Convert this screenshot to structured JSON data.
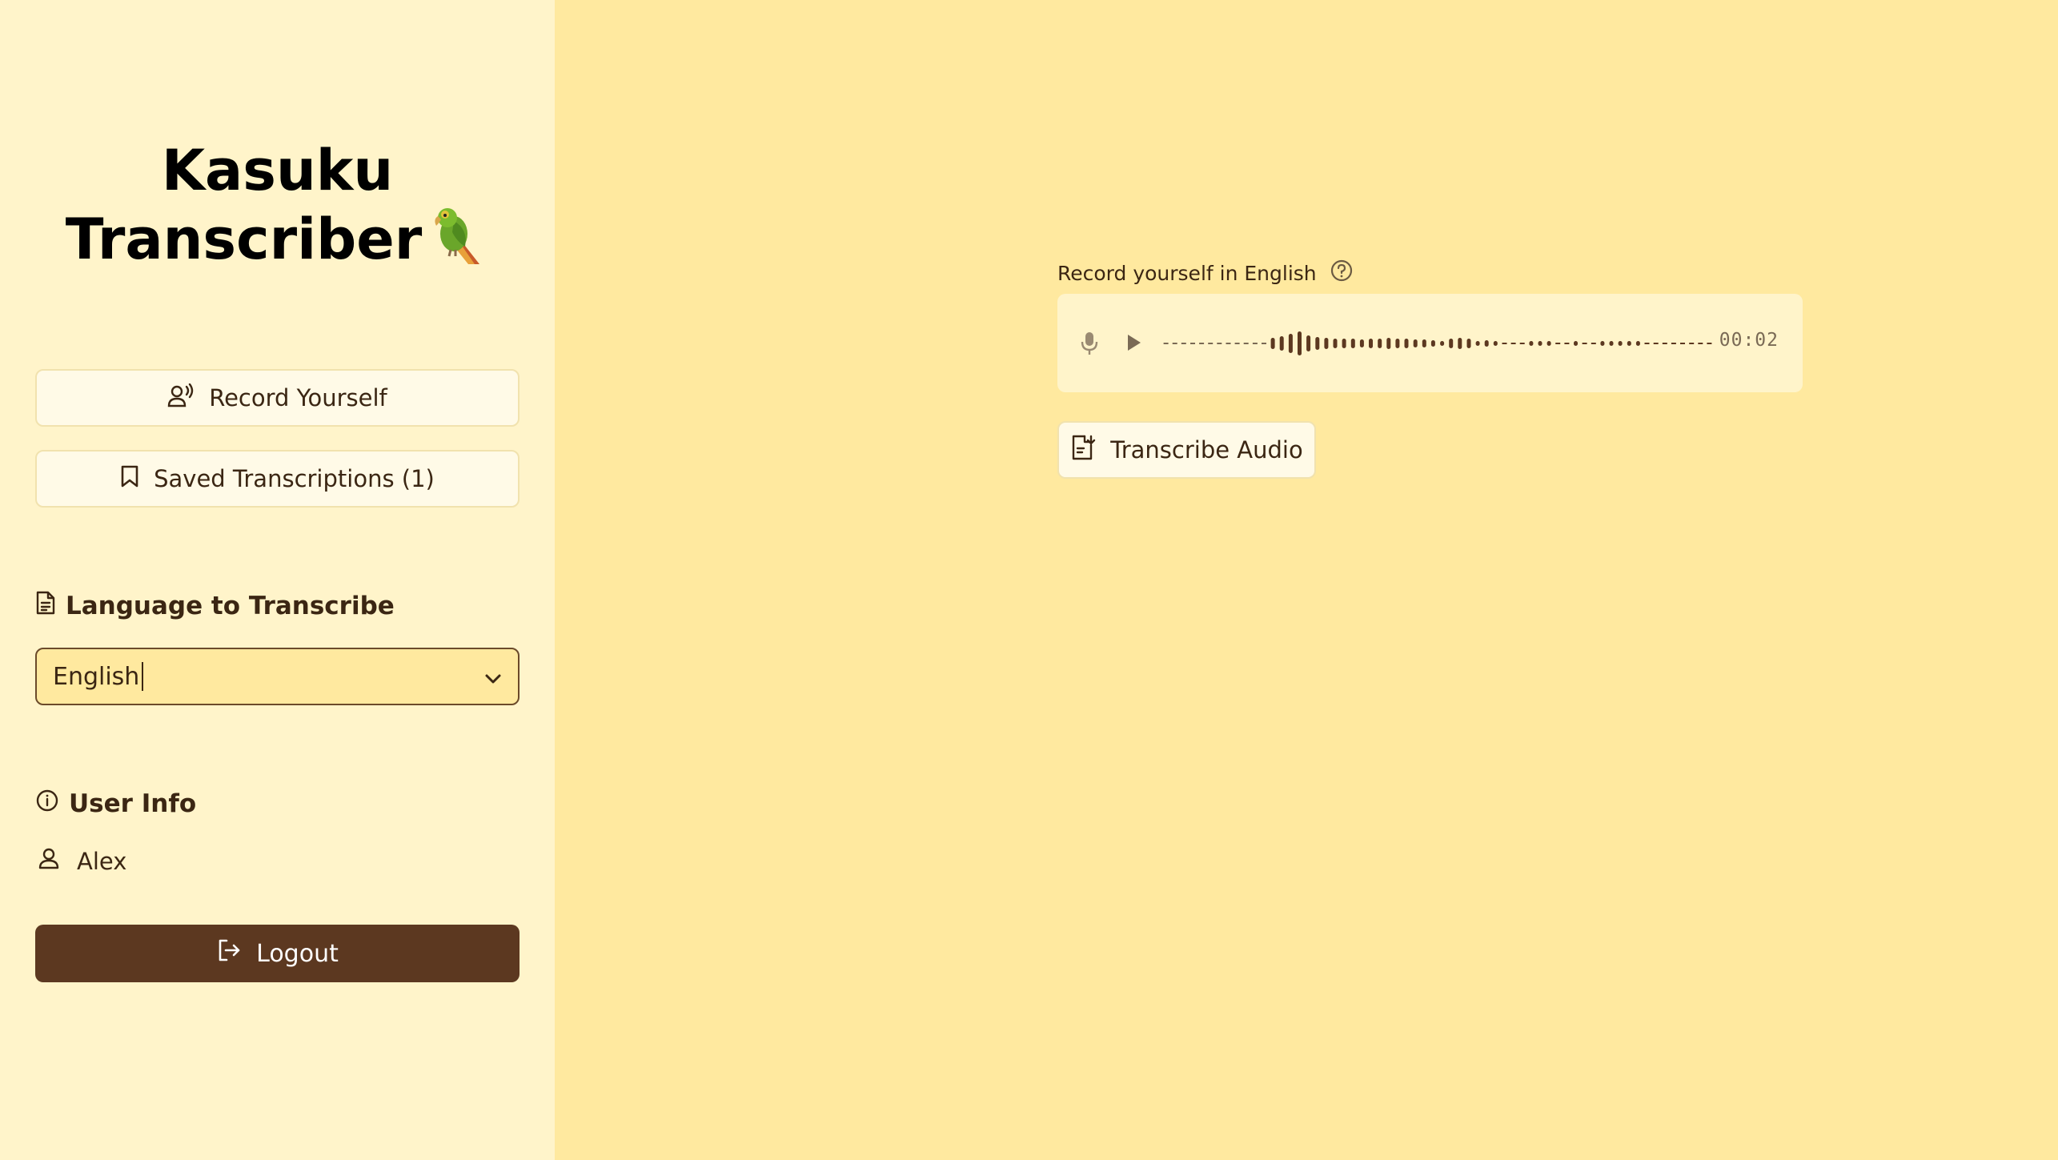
{
  "app": {
    "title_line1": "Kasuku",
    "title_line2": "Transcriber"
  },
  "sidebar": {
    "record_label": "Record Yourself",
    "saved_label": "Saved Transcriptions (1)",
    "language_section_title": "Language to Transcribe",
    "language_value": "English",
    "user_section_title": "User Info",
    "user_name": "Alex",
    "logout_label": "Logout"
  },
  "main": {
    "record_prompt": "Record yourself in English",
    "player_time": "00:02",
    "transcribe_label": "Transcribe Audio"
  },
  "colors": {
    "sidebar_bg": "#fff4ca",
    "main_bg": "#ffe99f",
    "accent_brown": "#5c3820",
    "text_brown": "#3b2613"
  },
  "icons": [
    "parrot-emoji",
    "record-voice-icon",
    "bookmark-icon",
    "document-icon",
    "chevron-down-icon",
    "info-icon",
    "user-icon",
    "logout-icon",
    "help-icon",
    "mic-icon",
    "play-icon",
    "transcribe-icon"
  ]
}
